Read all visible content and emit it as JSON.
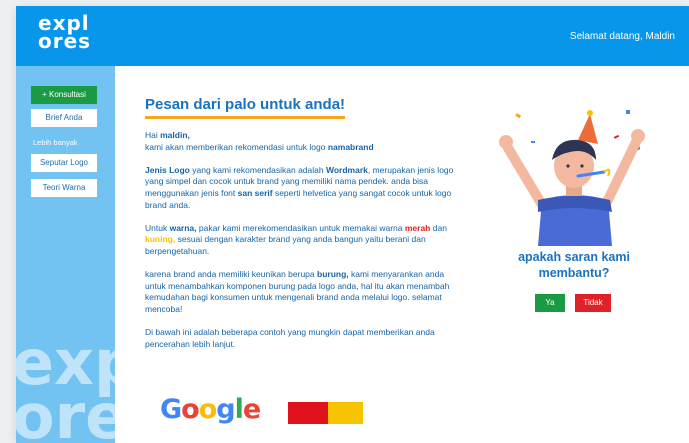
{
  "header": {
    "logo_line1": "expl",
    "logo_line2": "ores",
    "greeting": "Selamat datang, Maldin"
  },
  "sidebar": {
    "konsultasi_label": "+ Konsultasi",
    "brief_label": "Brief Anda",
    "more_label": "Lebih banyak",
    "seputar_logo_label": "Seputar Logo",
    "teori_warna_label": "Teori Warna",
    "watermark_line1": "expl",
    "watermark_line2": "ores"
  },
  "main": {
    "title": "Pesan dari palo untuk anda!",
    "p1": {
      "hai": "Hai ",
      "name": "maldin,",
      "line2": "kami akan memberikan rekomendasi untuk logo ",
      "brand": "namabrand"
    },
    "p2": {
      "jenis_logo": "Jenis Logo",
      "t1": " yang kami rekomendasikan adalah ",
      "wordmark": "Wordmark",
      "t2": ", merupakan jenis logo yang simpel dan cocok untuk brand yang memiliki nama pendek. anda bisa menggunakan jenis font ",
      "san_serif": "san serif",
      "t3": " seperti helvetica yang sangat cocok untuk logo brand anda."
    },
    "p3": {
      "t1": "Untuk ",
      "warna": "warna,",
      "t2": " pakar  kami merekomendasikan untuk memakai warna ",
      "merah": "merah",
      "t3": " dan ",
      "kuning": "kuning,",
      "t4": " sesuai dengan karakter brand yang anda bangun yaitu berani dan berpengetahuan."
    },
    "p4": {
      "t1": "karena brand anda memiliki keunikan berupa ",
      "burung": "burung,",
      "t2": " kami menyarankan anda untuk menambahkan komponen burung pada logo anda, hal itu akan menambah kemudahan bagi konsumen untuk mengenali brand anda melalui logo. selamat mencoba!"
    },
    "p5": "Di bawah ini adalah beberapa contoh yang mungkin dapat memberikan anda pencerahan lebih lanjut.",
    "examples": {
      "google_letters": [
        "G",
        "o",
        "o",
        "g",
        "l",
        "e"
      ],
      "google_colors": [
        "#4285f4",
        "#ea4335",
        "#fbbc05",
        "#4285f4",
        "#34a853",
        "#ea4335"
      ],
      "swatch_colors": [
        "#e0121c",
        "#f7c300"
      ]
    }
  },
  "feedback": {
    "question": "apakah saran kami membantu?",
    "yes_label": "Ya",
    "no_label": "Tidak"
  },
  "colors": {
    "header_blue": "#0896ea",
    "sidebar_blue": "#72c2f2",
    "title_blue": "#1a72c2",
    "accent_orange": "#f5a623",
    "green": "#1b9a44",
    "red": "#e0212a"
  }
}
